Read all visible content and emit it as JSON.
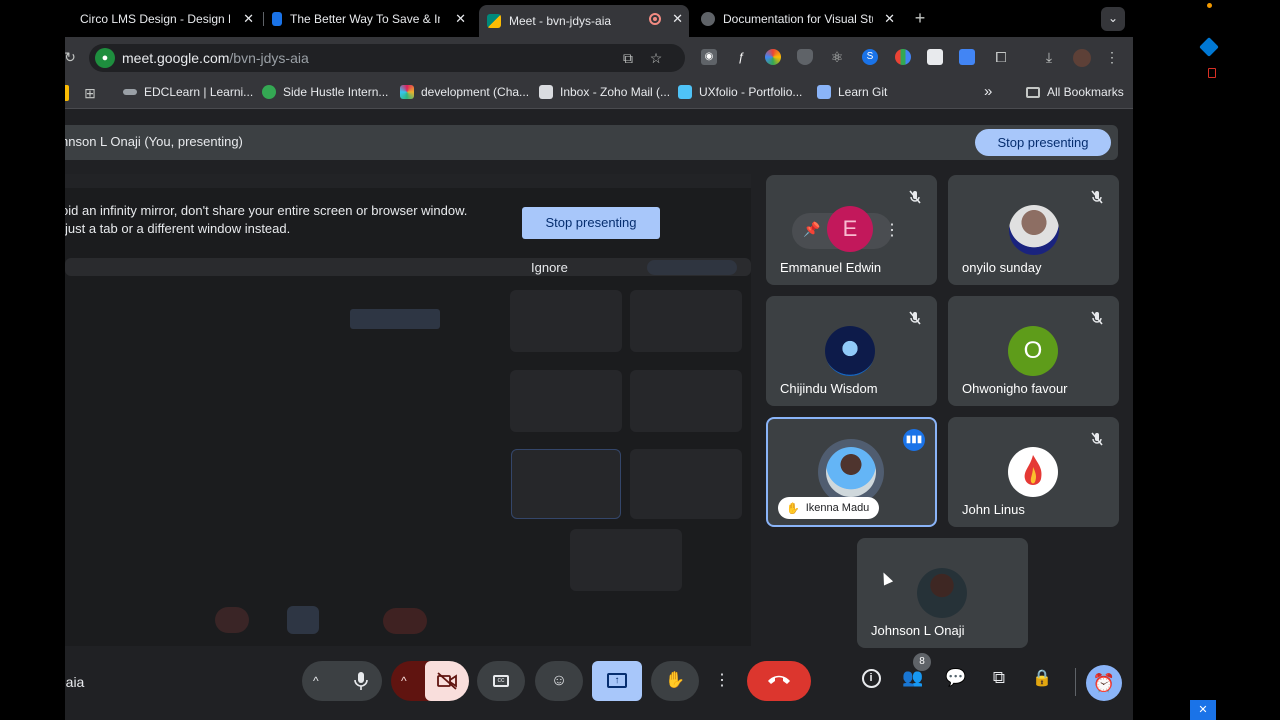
{
  "tabs": [
    {
      "title": "Circo LMS Design - Design Pa",
      "fav_color": "#000000",
      "active": false
    },
    {
      "title": "The Better Way To Save & Inv",
      "fav_color": "#1a73e8",
      "active": false
    },
    {
      "title": "Meet - bvn-jdys-aia",
      "fav_color": "#00897b",
      "active": true
    },
    {
      "title": "Documentation for Visual Stu",
      "fav_color": "#5f6368",
      "active": false
    }
  ],
  "new_tab_symbol": "+",
  "tab_menu_symbol": "⌄",
  "address": {
    "host": "meet.google.com",
    "path": "/bvn-jdys-aia"
  },
  "bookmarks": [
    {
      "label": "EDCLearn | Learni...",
      "color": "#9aa0a6"
    },
    {
      "label": "Side Hustle Intern...",
      "color": "#34a853"
    },
    {
      "label": "development (Cha...",
      "color": "#e01e5a"
    },
    {
      "label": "Inbox - Zoho Mail (...",
      "color": "#dadce0"
    },
    {
      "label": "UXfolio - Portfolio...",
      "color": "#4fc3f7"
    },
    {
      "label": "Learn Git",
      "color": "#8ab4f8"
    }
  ],
  "bookmarks_more": "»",
  "all_bookmarks": "All Bookmarks",
  "meet": {
    "presenting_text": "hnson L Onaji (You, presenting)",
    "stop_presenting": "Stop presenting",
    "mirror_warning_line1": "oid an infinity mirror, don't share your entire screen or browser window.",
    "mirror_warning_line2": "just a tab or a different window instead.",
    "mirror_stop": "Stop presenting",
    "mirror_ignore": "Ignore",
    "meeting_code": "-aia",
    "participant_count": "8"
  },
  "participants": [
    {
      "name": "Emmanuel Edwin",
      "muted": true,
      "initial": "E",
      "avatar_color": "#c2185b"
    },
    {
      "name": "onyilo sunday",
      "muted": true,
      "initial": "",
      "avatar_color": "#8d6e63"
    },
    {
      "name": "Chijindu Wisdom",
      "muted": true,
      "initial": "",
      "avatar_color": "#1a237e"
    },
    {
      "name": "Ohwonigho favour",
      "muted": true,
      "initial": "O",
      "avatar_color": "#5e9c1a"
    },
    {
      "name": "Ikenna Madu",
      "muted": false,
      "speaking": true,
      "initial": "",
      "avatar_color": "#4a6f8a"
    },
    {
      "name": "John Linus",
      "muted": true,
      "initial": "",
      "avatar_color": "#ffffff"
    },
    {
      "name": "Johnson L Onaji",
      "muted": false,
      "initial": "",
      "avatar_color": "#263238"
    }
  ],
  "colors": {
    "accent": "#a8c7fa",
    "end_call": "#dc362e",
    "camera_off": "#f9dedc",
    "present_active": "#a8c7fa",
    "speaking_border": "#8ab4f8"
  }
}
